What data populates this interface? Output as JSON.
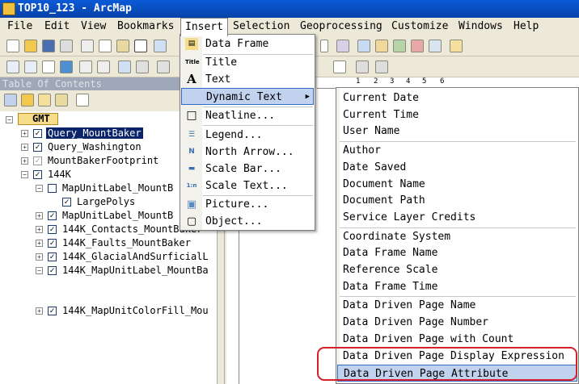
{
  "window": {
    "title": "TOP10_123 - ArcMap"
  },
  "menubar": {
    "items": [
      "File",
      "Edit",
      "View",
      "Bookmarks",
      "Insert",
      "Selection",
      "Geoprocessing",
      "Customize",
      "Windows",
      "Help"
    ]
  },
  "toc": {
    "title": "Table Of Contents",
    "root": "GMT",
    "items": [
      "Query_MountBaker",
      "Query_Washington",
      "MountBakerFootprint",
      "144K",
      "MapUnitLabel_MountB",
      "LargePolys",
      "MapUnitLabel_MountB",
      "144K_Contacts_MountBaker",
      "144K_Faults_MountBaker",
      "144K_GlacialAndSurficialL",
      "144K_MapUnitLabel_MountBa",
      "144K_MapUnitColorFill_Mou"
    ]
  },
  "insert_menu": {
    "items": [
      "Data Frame",
      "Title",
      "Text",
      "Dynamic Text",
      "Neatline...",
      "Legend...",
      "North Arrow...",
      "Scale Bar...",
      "Scale Text...",
      "Picture...",
      "Object..."
    ],
    "icons": [
      "data-frame-icon",
      "title-icon",
      "text-icon",
      "",
      "neatline-icon",
      "legend-icon",
      "north-arrow-icon",
      "scale-bar-icon",
      "scale-text-icon",
      "picture-icon",
      "object-icon"
    ],
    "icon_glyphs": [
      "▤",
      "Title",
      "A",
      "",
      "□",
      "☰",
      "N",
      "▬",
      "1:n",
      "▣",
      "▢"
    ]
  },
  "submenu_arrow": "▶",
  "dynamic_text_menu": {
    "items": [
      "Current Date",
      "Current Time",
      "User Name",
      "Author",
      "Date Saved",
      "Document Name",
      "Document Path",
      "Service Layer Credits",
      "Coordinate System",
      "Data Frame Name",
      "Reference Scale",
      "Data Frame Time",
      "Data Driven Page Name",
      "Data Driven Page Number",
      "Data Driven Page with Count",
      "Data Driven Page Display Expression",
      "Data Driven Page Attribute"
    ]
  },
  "ruler": {
    "labels": [
      "1",
      "2",
      "3",
      "4",
      "5",
      "6"
    ]
  },
  "colors": {
    "highlight": "#c1d2ee",
    "selection": "#0a246a",
    "annotation": "#d4202a"
  }
}
